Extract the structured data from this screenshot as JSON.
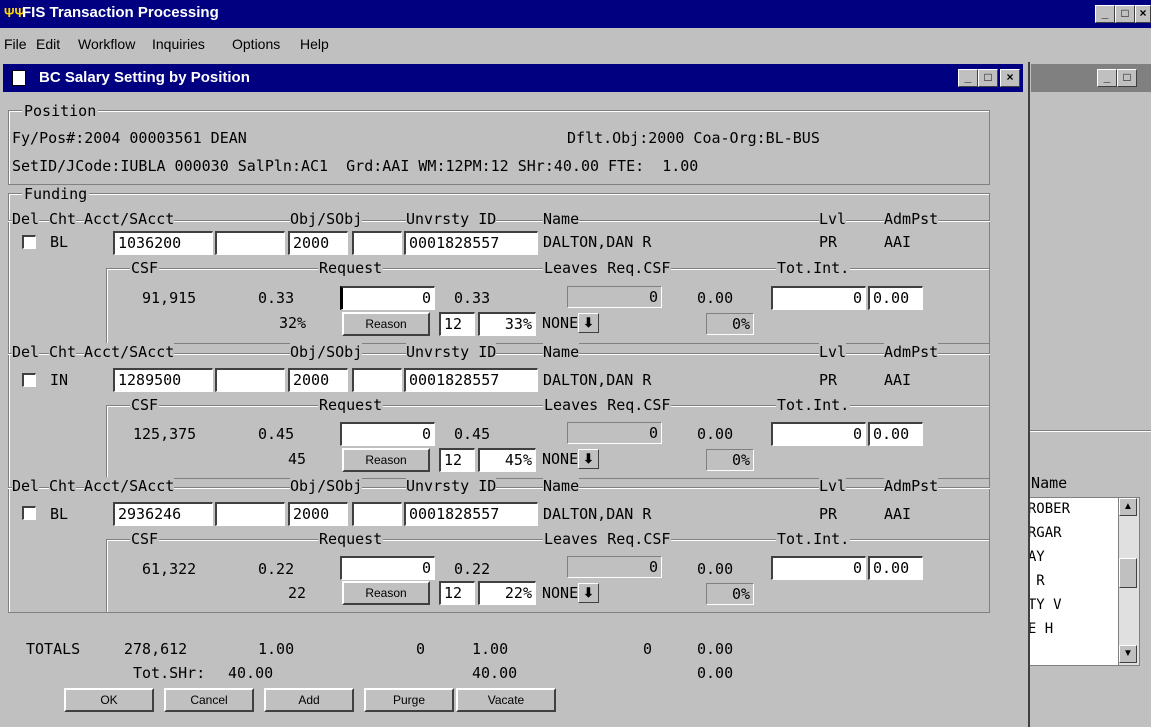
{
  "app": {
    "title": "FIS Transaction Processing",
    "icon": "app-logo-icon"
  },
  "window_buttons": {
    "minimize": "_",
    "maximize": "□",
    "close": "×"
  },
  "menu": [
    {
      "label": "File"
    },
    {
      "label": "Edit"
    },
    {
      "label": "Workflow"
    },
    {
      "label": "Inquiries"
    },
    {
      "label": "Options"
    },
    {
      "label": "Help"
    }
  ],
  "dialog": {
    "title": "BC Salary Setting by Position",
    "position": {
      "group_label": "Position",
      "line1_left": "Fy/Pos#:2004 00003561 DEAN",
      "line1_right": "Dflt.Obj:2000 Coa-Org:BL-BUS",
      "line2": "SetID/JCode:IUBLA 000030 SalPln:AC1  Grd:AAI WM:12PM:12 SHr:40.00 FTE:  1.00"
    },
    "funding_label": "Funding",
    "headers": {
      "del": "Del",
      "cht": "Cht",
      "acct": "Acct/SAcct",
      "obj": "Obj/SObj",
      "univ": "Unvrsty ID",
      "name": "Name",
      "lvl": "Lvl",
      "admpst": "AdmPst",
      "csf": "CSF",
      "request": "Request",
      "leaves": "Leaves Req.CSF",
      "totint": "Tot.Int.",
      "reason": "Reason",
      "none": "NONE"
    },
    "rows": [
      {
        "cht": "BL",
        "acct": "1036200",
        "sacct": "",
        "obj": "2000",
        "sobj": "",
        "univ_id": "0001828557",
        "name": "DALTON,DAN R",
        "lvl": "PR",
        "admpst": "AAI",
        "csf_amt": "91,915",
        "csf_fte": "0.33",
        "csf_pct": "32%",
        "req_amt": "0",
        "req_fte": "0.33",
        "months": "12",
        "req_pct": "33%",
        "leave_amt": "0",
        "leave_fte": "0.00",
        "leave_pct": "0%",
        "tot_int": "0",
        "tot_int_fte": "0.00"
      },
      {
        "cht": "IN",
        "acct": "1289500",
        "sacct": "",
        "obj": "2000",
        "sobj": "",
        "univ_id": "0001828557",
        "name": "DALTON,DAN R",
        "lvl": "PR",
        "admpst": "AAI",
        "csf_amt": "125,375",
        "csf_fte": "0.45",
        "csf_pct": "45",
        "req_amt": "0",
        "req_fte": "0.45",
        "months": "12",
        "req_pct": "45%",
        "leave_amt": "0",
        "leave_fte": "0.00",
        "leave_pct": "0%",
        "tot_int": "0",
        "tot_int_fte": "0.00"
      },
      {
        "cht": "BL",
        "acct": "2936246",
        "sacct": "",
        "obj": "2000",
        "sobj": "",
        "univ_id": "0001828557",
        "name": "DALTON,DAN R",
        "lvl": "PR",
        "admpst": "AAI",
        "csf_amt": "61,322",
        "csf_fte": "0.22",
        "csf_pct": "22",
        "req_amt": "0",
        "req_fte": "0.22",
        "months": "12",
        "req_pct": "22%",
        "leave_amt": "0",
        "leave_fte": "0.00",
        "leave_pct": "0%",
        "tot_int": "0",
        "tot_int_fte": "0.00"
      }
    ],
    "totals": {
      "label": "TOTALS",
      "csf_amt": "278,612",
      "csf_fte": "1.00",
      "req_amt": "0",
      "req_fte": "1.00",
      "leave_amt": "0",
      "leave_fte": "0.00",
      "shr_label": "Tot.SHr:",
      "shr_csf": "40.00",
      "shr_req": "40.00",
      "shr_leave": "0.00"
    },
    "buttons": {
      "ok": "OK",
      "cancel": "Cancel",
      "add": "Add",
      "purge": "Purge",
      "vacate": "Vacate"
    }
  },
  "background_window": {
    "column_header": "t Name",
    "list": [
      "Y,ROBER",
      "MARGAR",
      "IJAY",
      "AN R",
      "ETTY V",
      "RGE H"
    ]
  }
}
